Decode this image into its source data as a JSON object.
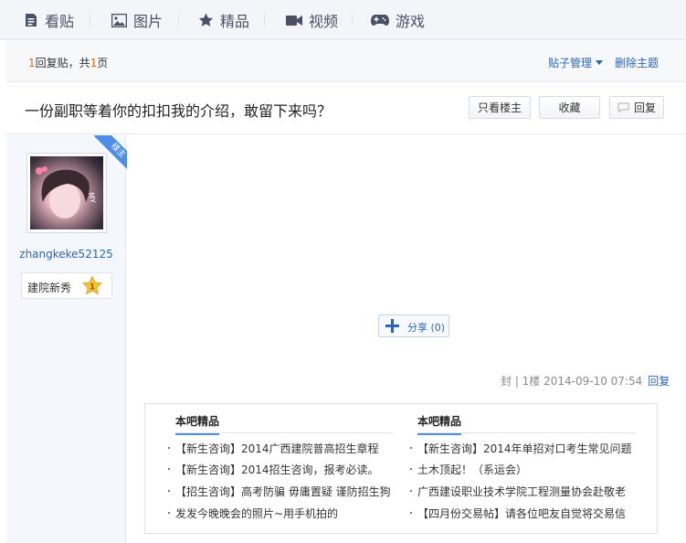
{
  "nav": {
    "items": [
      {
        "label": "看贴",
        "icon": "document-icon"
      },
      {
        "label": "图片",
        "icon": "image-icon"
      },
      {
        "label": "精品",
        "icon": "star-icon"
      },
      {
        "label": "视频",
        "icon": "video-camera-icon"
      },
      {
        "label": "游戏",
        "icon": "gamepad-icon"
      }
    ]
  },
  "infobar": {
    "reply_count": "1",
    "reply_text": "回复贴，共",
    "page_count": "1",
    "page_text": "页",
    "manage_label": "贴子管理",
    "delete_label": "删除主题"
  },
  "post": {
    "title": "一份副职等着你的扣扣我的介绍，敢留下来吗？",
    "only_op_label": "只看楼主",
    "favorite_label": "收藏",
    "reply_label": "回复"
  },
  "author": {
    "badge": "楼主",
    "name": "zhangkeke52125",
    "level_name": "建院新秀",
    "level_number": "1"
  },
  "share": {
    "label": "分享",
    "count": "(0)"
  },
  "postmeta": {
    "text": "封 | 1楼  2014-09-10 07:54",
    "reply_label": "回复"
  },
  "recommended": {
    "columns": [
      {
        "heading": "本吧精品",
        "items": [
          "【新生咨询】2014广西建院普高招生章程",
          "【新生咨询】2014招生咨询，报考必读。",
          "【招生咨询】高考防骗 毋庸置疑 谨防招生狗",
          "发发今晚晚会的照片~用手机拍的"
        ]
      },
      {
        "heading": "本吧精品",
        "items": [
          "【新生咨询】2014年单招对口考生常见问题",
          "土木顶起！（系运会）",
          "广西建设职业技术学院工程测量协会赴敬老",
          "【四月份交易帖】请各位吧友自觉将交易信"
        ]
      }
    ]
  },
  "colors": {
    "link_blue": "#2d64b3",
    "accent_orange": "#f25f19",
    "badge_blue": "#4d8de6"
  }
}
